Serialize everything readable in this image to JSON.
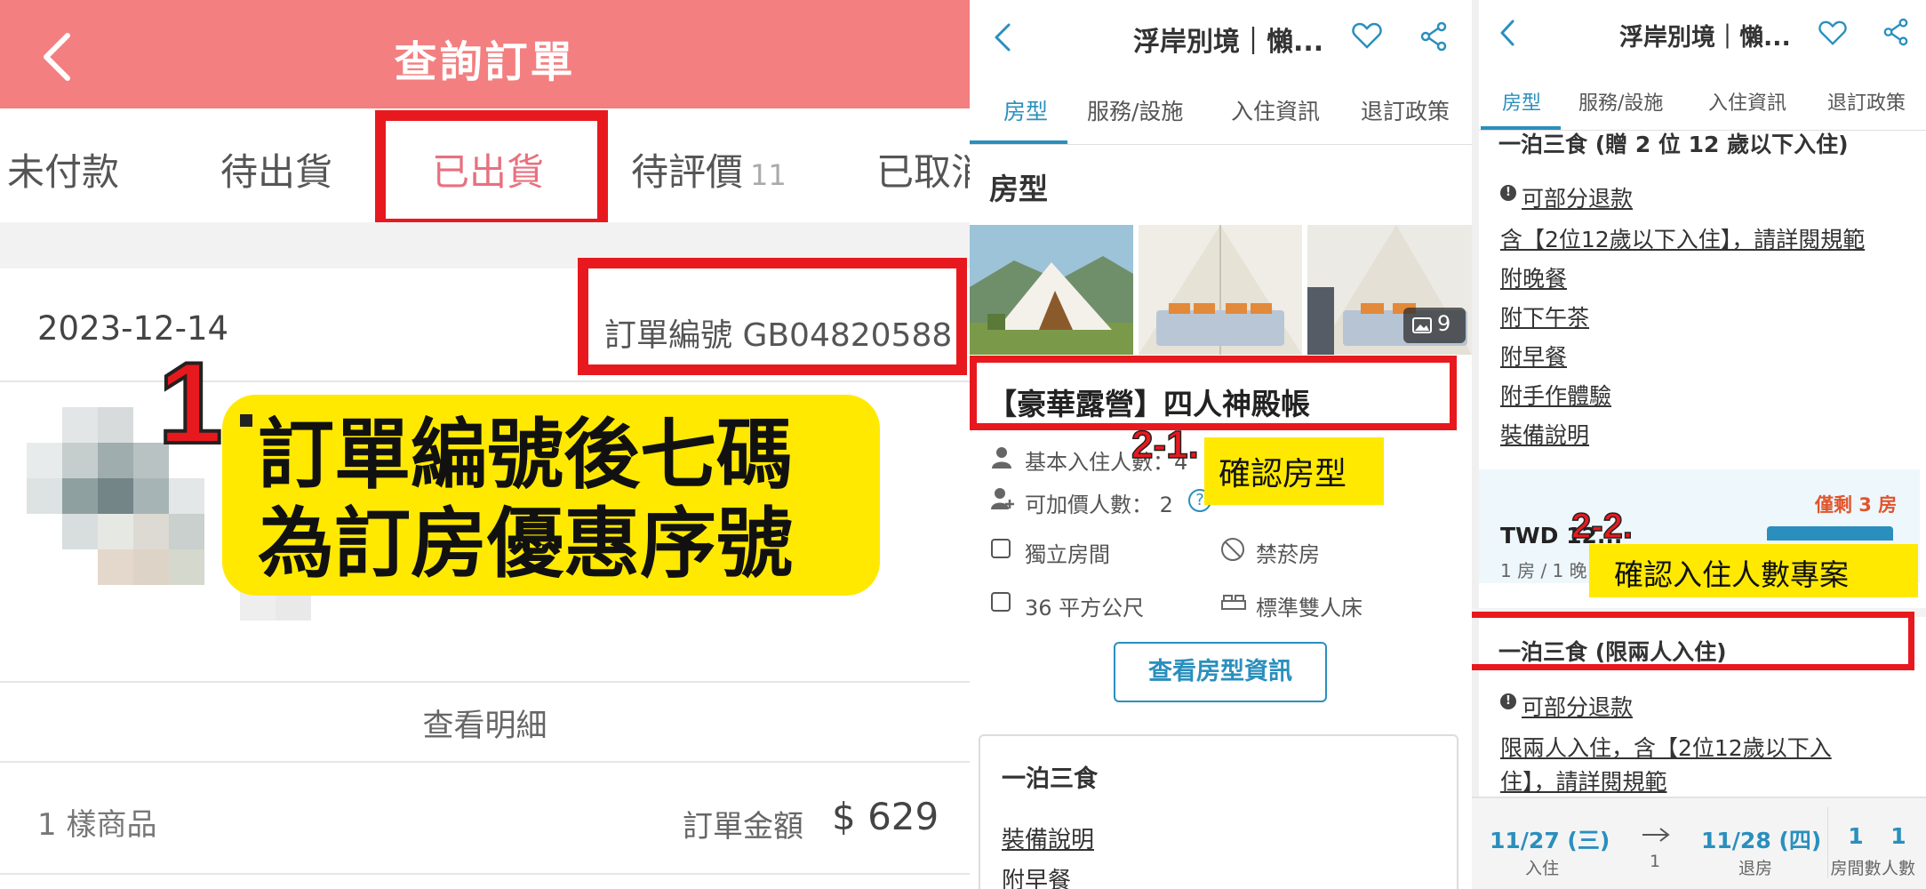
{
  "panel1": {
    "title": "查詢訂單",
    "tabs": [
      {
        "label": "未付款"
      },
      {
        "label": "待出貨"
      },
      {
        "label": "已出貨"
      },
      {
        "label": "待評價",
        "badge": "11"
      },
      {
        "label": "已取消"
      }
    ],
    "order_date": "2023-12-14",
    "order_number": "訂單編號 GB04820588",
    "annotation_number": "1",
    "annotation_text_line1": "訂單編號後七碼",
    "annotation_text_line2": "為訂房優惠序號",
    "detail_link": "查看明細",
    "item_count": "1 樣商品",
    "total_label": "訂單金額",
    "total_value": "$ 629"
  },
  "panel2": {
    "header_title": "浮岸別境｜懶...",
    "tabs": [
      "房型",
      "服務/設施",
      "入住資訊",
      "退訂政策"
    ],
    "section_title": "房型",
    "photo_count": "9",
    "room_name": "【豪華露營】四人神殿帳",
    "base_occupancy": "基本入住人數：4",
    "extra_occupancy": "可加價人數： 2",
    "feature_1": "獨立房間",
    "feature_2": "禁菸房",
    "feature_3": "36 平方公尺",
    "feature_4": "標準雙人床",
    "annotation_badge": "2-1.",
    "annotation_text": "確認房型",
    "view_room_button": "查看房型資訊",
    "plan_title": "一泊三食",
    "plan_links": [
      "裝備說明",
      "附早餐"
    ]
  },
  "panel3": {
    "header_title": "浮岸別境｜懶...",
    "tabs": [
      "房型",
      "服務/設施",
      "入住資訊",
      "退訂政策"
    ],
    "plan1_title": "一泊三食 (贈 2 位 12 歲以下入住)",
    "plan1_refund": "可部分退款",
    "plan1_links": [
      "含【2位12歲以下入住】，請詳閱規範",
      "附晚餐",
      "附下午茶",
      "附早餐",
      "附手作體驗",
      "裝備說明"
    ],
    "rooms_left": "僅剩 3 房",
    "price": "TWD 12...",
    "price_sub": "1 房 / 1 晚",
    "annotation_badge": "2-2.",
    "annotation_text": "確認入住人數專案",
    "plan2_title": "一泊三食 (限兩人入住)",
    "plan2_refund": "可部分退款",
    "plan2_desc_line1": "限兩人入住，含【2位12歲以下入",
    "plan2_desc_line2": "住】，請詳閱規範",
    "checkin_date": "11/27 (三)",
    "checkin_label": "入住",
    "nights": "1",
    "checkout_date": "11/28 (四)",
    "checkout_label": "退房",
    "rooms_value": "1",
    "rooms_label": "房間數",
    "people_value": "1",
    "people_label": "人數"
  },
  "colors": {
    "header_pink": "#f37f80",
    "active_tab_pink": "#e8707f",
    "annotation_red": "#e8191e",
    "annotation_yellow": "#ffe900",
    "accent_blue": "#2a8fbd"
  },
  "icons": [
    "back-chevron-icon",
    "heart-icon",
    "share-icon",
    "person-icon",
    "person-plus-icon",
    "door-icon",
    "no-smoking-icon",
    "area-icon",
    "bed-icon",
    "gallery-icon",
    "info-icon",
    "arrow-right-icon"
  ]
}
